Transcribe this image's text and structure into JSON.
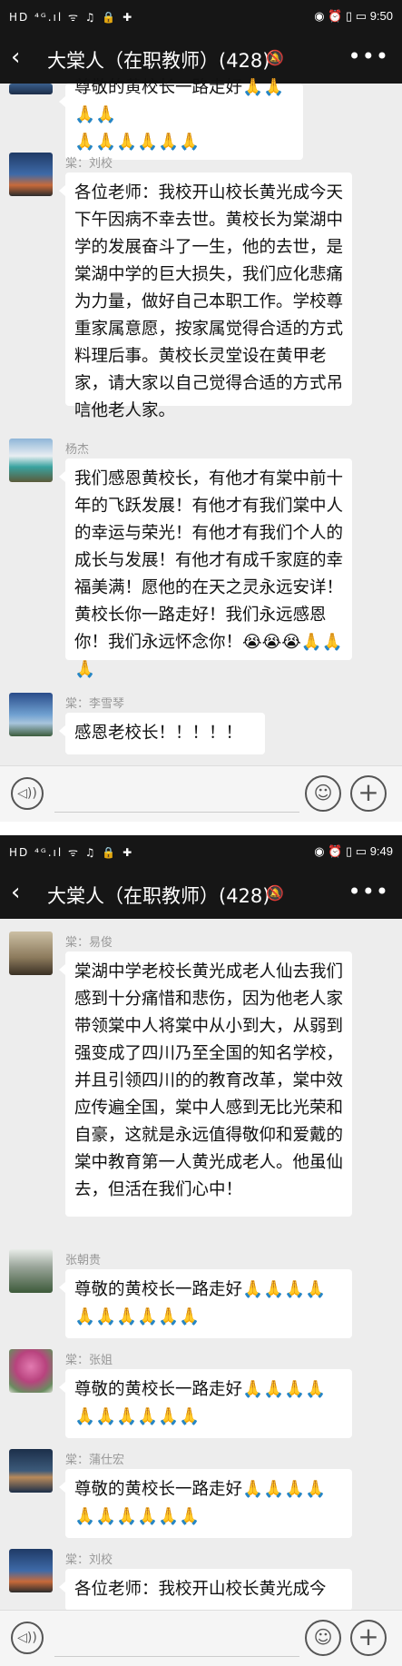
{
  "screens": [
    {
      "status": {
        "left": "HD ⁴ᴳ.ıl ᯤ ♫ 🔒 ✚",
        "right": "◉ ⏰ ▯ ▭ 9:50"
      },
      "header": {
        "title": "大棠人（在职教师）(428)",
        "back_icon": "‹",
        "more_icon": "•••"
      },
      "messages": [
        {
          "name": "",
          "text": "尊敬的黄校长一路走好🙏🙏🙏🙏\n🙏🙏🙏🙏🙏🙏"
        },
        {
          "name": "棠：刘校",
          "text": "各位老师：我校开山校长黄光成今天下午因病不幸去世。黄校长为棠湖中学的发展奋斗了一生，他的去世，是棠湖中学的巨大损失，我们应化悲痛为力量，做好自己本职工作。学校尊重家属意愿，按家属觉得合适的方式料理后事。黄校长灵堂设在黄甲老家，请大家以自己觉得合适的方式吊唁他老人家。"
        },
        {
          "name": "杨杰",
          "text": "我们感恩黄校长，有他才有棠中前十年的飞跃发展！有他才有我们棠中人的幸运与荣光！有他才有我们个人的成长与发展！有他才有成千家庭的幸福美满！愿他的在天之灵永远安详！黄校长你一路走好！我们永远感恩你！我们永远怀念你！😭😭😭🙏🙏🙏"
        },
        {
          "name": "棠：李雪琴",
          "text": "感恩老校长！！！！！"
        }
      ]
    },
    {
      "status": {
        "left": "HD ⁴ᴳ.ıl ᯤ ♫ 🔒 ✚",
        "right": "◉ ⏰ ▯ ▭ 9:49"
      },
      "header": {
        "title": "大棠人（在职教师）(428)",
        "back_icon": "‹",
        "more_icon": "•••"
      },
      "messages": [
        {
          "name": "棠：易俊",
          "text": "棠湖中学老校长黄光成老人仙去我们感到十分痛惜和悲伤，因为他老人家带领棠中人将棠中从小到大，从弱到强变成了四川乃至全国的知名学校，并且引领四川的的教育改革，棠中效应传遍全国，棠中人感到无比光荣和自豪，这就是永远值得敬仰和爱戴的棠中教育第一人黄光成老人。他虽仙去，但活在我们心中！"
        },
        {
          "name": "张朝贵",
          "text": "尊敬的黄校长一路走好🙏🙏🙏🙏\n🙏🙏🙏🙏🙏🙏"
        },
        {
          "name": "棠：张姐",
          "text": "尊敬的黄校长一路走好🙏🙏🙏🙏\n🙏🙏🙏🙏🙏🙏"
        },
        {
          "name": "棠：蒲仕宏",
          "text": "尊敬的黄校长一路走好🙏🙏🙏🙏\n🙏🙏🙏🙏🙏🙏"
        },
        {
          "name": "棠：刘校",
          "text": "各位老师：我校开山校长黄光成今"
        }
      ]
    }
  ],
  "colors": {
    "bar": "#161616",
    "chat_bg": "#ededed",
    "bubble": "#ffffff"
  },
  "icons": {
    "mute": "mute-bell-icon",
    "voice": "voice-icon",
    "emoji": "emoji-icon",
    "plus": "plus-icon"
  },
  "input": {
    "voice": "◁))",
    "emoji": "☺",
    "plus": "+",
    "mute": "🔕"
  }
}
